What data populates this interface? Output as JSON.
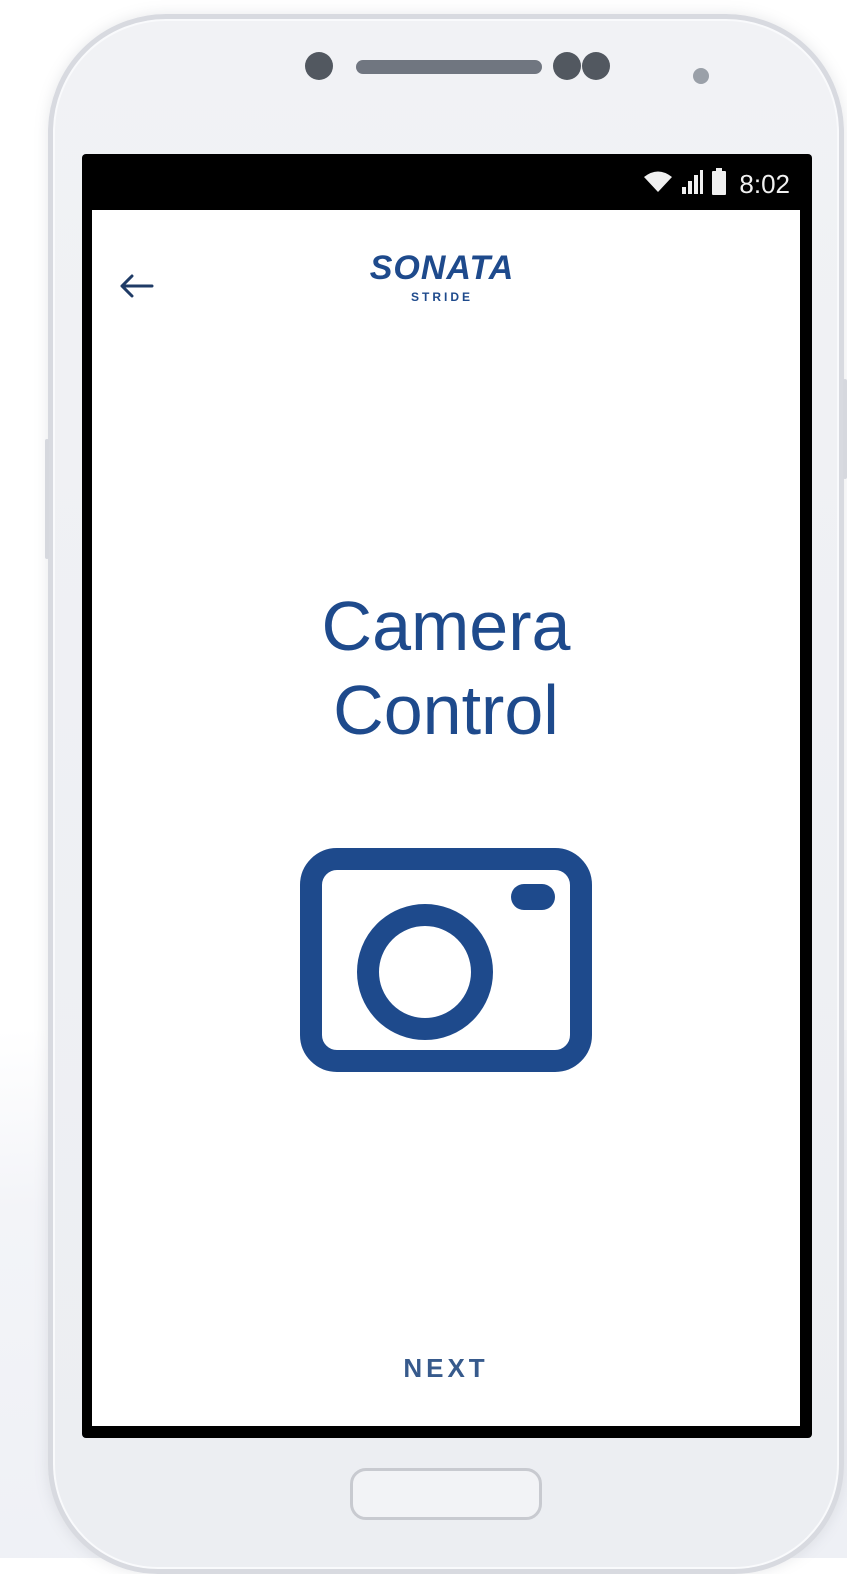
{
  "status_bar": {
    "time": "8:02",
    "icons": [
      "wifi-icon",
      "signal-icon",
      "battery-icon"
    ]
  },
  "header": {
    "back_icon": "arrow-left-icon",
    "logo_title": "SONATA",
    "logo_subtitle": "STRIDE"
  },
  "main": {
    "title_line1": "Camera",
    "title_line2": "Control",
    "feature_icon": "camera-icon"
  },
  "footer": {
    "next_label": "NEXT"
  },
  "colors": {
    "brand": "#1e4a8c",
    "next_text": "#375a8c",
    "screen_bezel": "#000000",
    "phone_body": "#eceef2"
  }
}
